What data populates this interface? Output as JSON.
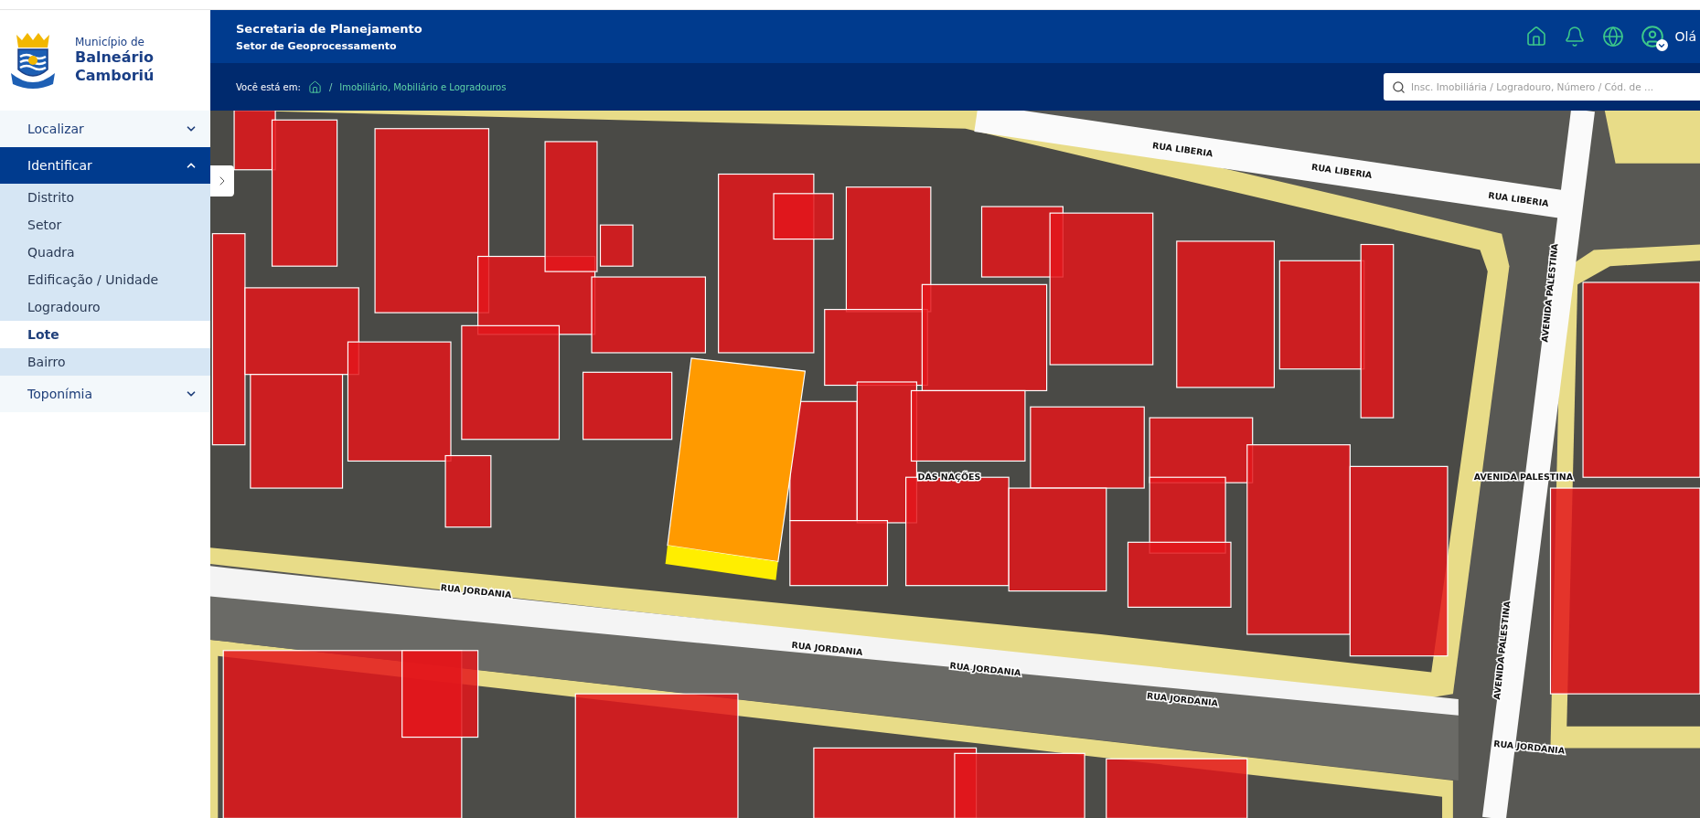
{
  "header": {
    "logo": {
      "line1": "Município de",
      "line2": "Balneário",
      "line3": "Camboriú"
    },
    "title": "Secretaria de Planejamento",
    "subtitle": "Setor de Geoprocessamento",
    "breadcrumb": {
      "label": "Você está em:",
      "separator": "/",
      "current": "Imobiliário, Mobiliário e Logradouros"
    },
    "user_greeting": "Olá",
    "search": {
      "placeholder": "Insc. Imobiliária / Logradouro, Número / Cód. de ..."
    }
  },
  "sidebar": {
    "items": [
      {
        "label": "Localizar",
        "expanded": false,
        "selected": false
      },
      {
        "label": "Identificar",
        "expanded": true,
        "selected": true,
        "children": [
          {
            "label": "Distrito",
            "selected": false
          },
          {
            "label": "Setor",
            "selected": false
          },
          {
            "label": "Quadra",
            "selected": false
          },
          {
            "label": "Edificação / Unidade",
            "selected": false
          },
          {
            "label": "Logradouro",
            "selected": false
          },
          {
            "label": "Lote",
            "selected": true
          },
          {
            "label": "Bairro",
            "selected": false
          }
        ]
      },
      {
        "label": "Toponímia",
        "expanded": false,
        "selected": false
      }
    ]
  },
  "map": {
    "labels": [
      "RUA LIBERIA",
      "RUA LIBERIA",
      "RUA LIBERIA",
      "AVENIDA PALESTINA",
      "DAS NAÇÕES",
      "AVENIDA PALESTINA",
      "RUA JORDANIA",
      "AVENIDA PALESTINA",
      "RUA JORDANIA",
      "RUA JORDANIA",
      "RUA JORDANIA",
      "RUA JORDANIA"
    ]
  }
}
